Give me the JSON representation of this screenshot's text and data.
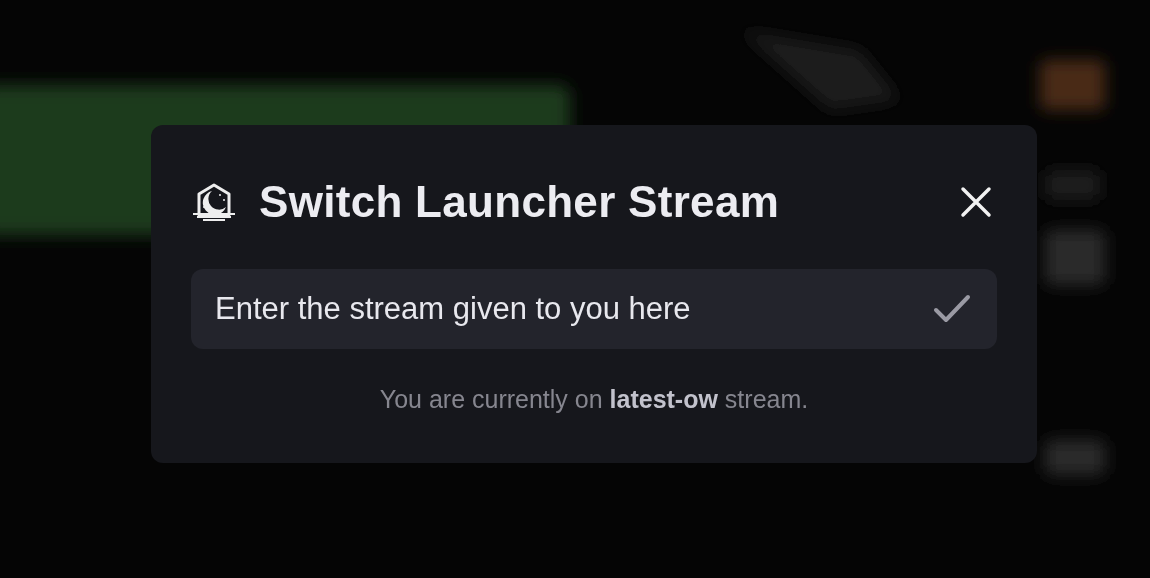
{
  "dialog": {
    "title": "Switch Launcher Stream",
    "input": {
      "value": "Enter the stream given to you here"
    },
    "status": "You are currently on **latest-ow** stream."
  }
}
